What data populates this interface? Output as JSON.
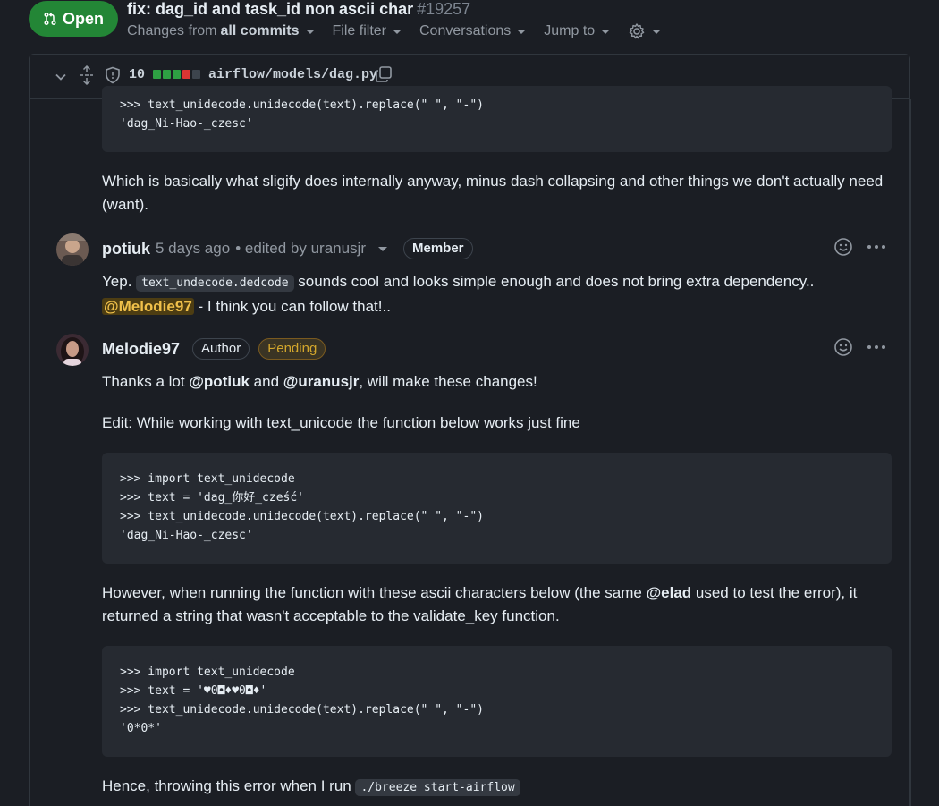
{
  "header": {
    "status_label": "Open",
    "title": "fix: dag_id and task_id non ascii char",
    "number": "#19257",
    "changes_prefix": "Changes from",
    "changes_value": "all commits",
    "file_filter": "File filter",
    "conversations": "Conversations",
    "jump_to": "Jump to"
  },
  "file": {
    "changed_count": "10",
    "path": "airflow/models/dag.py",
    "diffbar_colors": [
      "#2ea043",
      "#2ea043",
      "#2ea043",
      "#da3633",
      "#3d444d"
    ]
  },
  "top_code": {
    "lines": [
      ">>> text_unidecode.unidecode(text).replace(\" \", \"-\")",
      "'dag_Ni-Hao-_czesc'"
    ]
  },
  "comment0": {
    "body": "Which is basically what sligify does internally anyway, minus dash collapsing and other things we don't actually need (want)."
  },
  "comment1": {
    "author": "potiuk",
    "time": "5 days ago",
    "edited": "• edited by uranusjr",
    "role": "Member",
    "text_before": "Yep.",
    "code": "text_undecode.dedcode",
    "text_after": "sounds cool and looks simple enough and does not bring extra dependency..",
    "mention": "@Melodie97",
    "text_end": "- I think you can follow that!.."
  },
  "comment2": {
    "author": "Melodie97",
    "role": "Author",
    "status": "Pending",
    "p1_start": "Thanks a lot",
    "p1_mention1": "@potiuk",
    "p1_and": "and",
    "p1_mention2": "@uranusjr",
    "p1_end": ", will make these changes!",
    "p2": "Edit: While working with text_unicode the function below works just fine",
    "code1": [
      ">>> import text_unidecode",
      ">>> text = 'dag_你好_cześć'",
      ">>> text_unidecode.unidecode(text).replace(\" \", \"-\")",
      "'dag_Ni-Hao-_czesc'"
    ],
    "p3_start": "However, when running the function with these ascii characters below (the same",
    "p3_mention": "@elad",
    "p3_end": "used to test the error), it returned a string that wasn't acceptable to the validate_key function.",
    "code2": [
      ">>> import text_unidecode",
      ">>> text = '♥0◘♦♥0◘♦'",
      ">>> text_unidecode.unidecode(text).replace(\" \", \"-\")",
      "'0*0*'"
    ],
    "p4": "Hence, throwing this error when I run",
    "p4_code": "./breeze start-airflow"
  }
}
